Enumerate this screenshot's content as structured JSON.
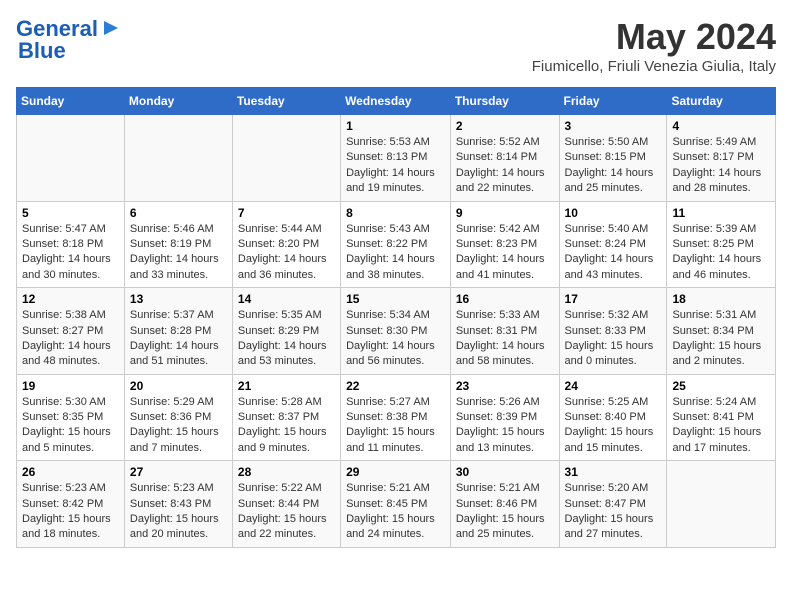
{
  "logo": {
    "line1": "General",
    "line2": "Blue",
    "arrow": "▶"
  },
  "title": "May 2024",
  "location": "Fiumicello, Friuli Venezia Giulia, Italy",
  "headers": [
    "Sunday",
    "Monday",
    "Tuesday",
    "Wednesday",
    "Thursday",
    "Friday",
    "Saturday"
  ],
  "weeks": [
    [
      {
        "num": "",
        "sunrise": "",
        "sunset": "",
        "daylight": ""
      },
      {
        "num": "",
        "sunrise": "",
        "sunset": "",
        "daylight": ""
      },
      {
        "num": "",
        "sunrise": "",
        "sunset": "",
        "daylight": ""
      },
      {
        "num": "1",
        "sunrise": "Sunrise: 5:53 AM",
        "sunset": "Sunset: 8:13 PM",
        "daylight": "Daylight: 14 hours and 19 minutes."
      },
      {
        "num": "2",
        "sunrise": "Sunrise: 5:52 AM",
        "sunset": "Sunset: 8:14 PM",
        "daylight": "Daylight: 14 hours and 22 minutes."
      },
      {
        "num": "3",
        "sunrise": "Sunrise: 5:50 AM",
        "sunset": "Sunset: 8:15 PM",
        "daylight": "Daylight: 14 hours and 25 minutes."
      },
      {
        "num": "4",
        "sunrise": "Sunrise: 5:49 AM",
        "sunset": "Sunset: 8:17 PM",
        "daylight": "Daylight: 14 hours and 28 minutes."
      }
    ],
    [
      {
        "num": "5",
        "sunrise": "Sunrise: 5:47 AM",
        "sunset": "Sunset: 8:18 PM",
        "daylight": "Daylight: 14 hours and 30 minutes."
      },
      {
        "num": "6",
        "sunrise": "Sunrise: 5:46 AM",
        "sunset": "Sunset: 8:19 PM",
        "daylight": "Daylight: 14 hours and 33 minutes."
      },
      {
        "num": "7",
        "sunrise": "Sunrise: 5:44 AM",
        "sunset": "Sunset: 8:20 PM",
        "daylight": "Daylight: 14 hours and 36 minutes."
      },
      {
        "num": "8",
        "sunrise": "Sunrise: 5:43 AM",
        "sunset": "Sunset: 8:22 PM",
        "daylight": "Daylight: 14 hours and 38 minutes."
      },
      {
        "num": "9",
        "sunrise": "Sunrise: 5:42 AM",
        "sunset": "Sunset: 8:23 PM",
        "daylight": "Daylight: 14 hours and 41 minutes."
      },
      {
        "num": "10",
        "sunrise": "Sunrise: 5:40 AM",
        "sunset": "Sunset: 8:24 PM",
        "daylight": "Daylight: 14 hours and 43 minutes."
      },
      {
        "num": "11",
        "sunrise": "Sunrise: 5:39 AM",
        "sunset": "Sunset: 8:25 PM",
        "daylight": "Daylight: 14 hours and 46 minutes."
      }
    ],
    [
      {
        "num": "12",
        "sunrise": "Sunrise: 5:38 AM",
        "sunset": "Sunset: 8:27 PM",
        "daylight": "Daylight: 14 hours and 48 minutes."
      },
      {
        "num": "13",
        "sunrise": "Sunrise: 5:37 AM",
        "sunset": "Sunset: 8:28 PM",
        "daylight": "Daylight: 14 hours and 51 minutes."
      },
      {
        "num": "14",
        "sunrise": "Sunrise: 5:35 AM",
        "sunset": "Sunset: 8:29 PM",
        "daylight": "Daylight: 14 hours and 53 minutes."
      },
      {
        "num": "15",
        "sunrise": "Sunrise: 5:34 AM",
        "sunset": "Sunset: 8:30 PM",
        "daylight": "Daylight: 14 hours and 56 minutes."
      },
      {
        "num": "16",
        "sunrise": "Sunrise: 5:33 AM",
        "sunset": "Sunset: 8:31 PM",
        "daylight": "Daylight: 14 hours and 58 minutes."
      },
      {
        "num": "17",
        "sunrise": "Sunrise: 5:32 AM",
        "sunset": "Sunset: 8:33 PM",
        "daylight": "Daylight: 15 hours and 0 minutes."
      },
      {
        "num": "18",
        "sunrise": "Sunrise: 5:31 AM",
        "sunset": "Sunset: 8:34 PM",
        "daylight": "Daylight: 15 hours and 2 minutes."
      }
    ],
    [
      {
        "num": "19",
        "sunrise": "Sunrise: 5:30 AM",
        "sunset": "Sunset: 8:35 PM",
        "daylight": "Daylight: 15 hours and 5 minutes."
      },
      {
        "num": "20",
        "sunrise": "Sunrise: 5:29 AM",
        "sunset": "Sunset: 8:36 PM",
        "daylight": "Daylight: 15 hours and 7 minutes."
      },
      {
        "num": "21",
        "sunrise": "Sunrise: 5:28 AM",
        "sunset": "Sunset: 8:37 PM",
        "daylight": "Daylight: 15 hours and 9 minutes."
      },
      {
        "num": "22",
        "sunrise": "Sunrise: 5:27 AM",
        "sunset": "Sunset: 8:38 PM",
        "daylight": "Daylight: 15 hours and 11 minutes."
      },
      {
        "num": "23",
        "sunrise": "Sunrise: 5:26 AM",
        "sunset": "Sunset: 8:39 PM",
        "daylight": "Daylight: 15 hours and 13 minutes."
      },
      {
        "num": "24",
        "sunrise": "Sunrise: 5:25 AM",
        "sunset": "Sunset: 8:40 PM",
        "daylight": "Daylight: 15 hours and 15 minutes."
      },
      {
        "num": "25",
        "sunrise": "Sunrise: 5:24 AM",
        "sunset": "Sunset: 8:41 PM",
        "daylight": "Daylight: 15 hours and 17 minutes."
      }
    ],
    [
      {
        "num": "26",
        "sunrise": "Sunrise: 5:23 AM",
        "sunset": "Sunset: 8:42 PM",
        "daylight": "Daylight: 15 hours and 18 minutes."
      },
      {
        "num": "27",
        "sunrise": "Sunrise: 5:23 AM",
        "sunset": "Sunset: 8:43 PM",
        "daylight": "Daylight: 15 hours and 20 minutes."
      },
      {
        "num": "28",
        "sunrise": "Sunrise: 5:22 AM",
        "sunset": "Sunset: 8:44 PM",
        "daylight": "Daylight: 15 hours and 22 minutes."
      },
      {
        "num": "29",
        "sunrise": "Sunrise: 5:21 AM",
        "sunset": "Sunset: 8:45 PM",
        "daylight": "Daylight: 15 hours and 24 minutes."
      },
      {
        "num": "30",
        "sunrise": "Sunrise: 5:21 AM",
        "sunset": "Sunset: 8:46 PM",
        "daylight": "Daylight: 15 hours and 25 minutes."
      },
      {
        "num": "31",
        "sunrise": "Sunrise: 5:20 AM",
        "sunset": "Sunset: 8:47 PM",
        "daylight": "Daylight: 15 hours and 27 minutes."
      },
      {
        "num": "",
        "sunrise": "",
        "sunset": "",
        "daylight": ""
      }
    ]
  ]
}
